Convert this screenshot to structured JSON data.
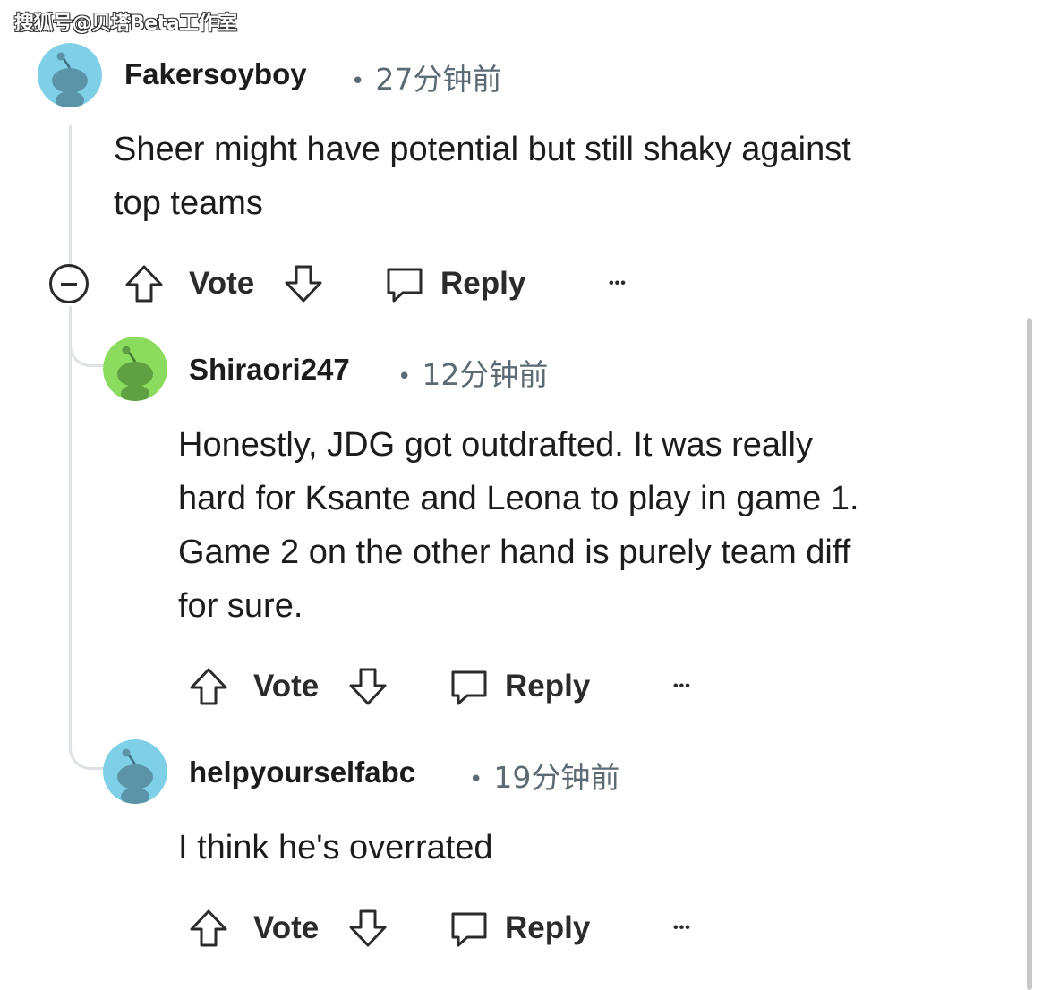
{
  "watermark": "搜狐号@贝塔Beta工作室",
  "comments": [
    {
      "author": "Fakersoyboy",
      "time": "27分钟前",
      "body_lines": [
        "Sheer might have potential but still shaky against",
        "top teams"
      ],
      "avatar_color": "#7fd0e6",
      "actions": {
        "vote": "Vote",
        "reply": "Reply",
        "more": "•••"
      }
    },
    {
      "author": "Shiraori247",
      "time": "12分钟前",
      "body_lines": [
        "Honestly, JDG got outdrafted. It was really",
        "hard for Ksante and Leona to play in game 1.",
        "Game 2 on the other hand is purely team diff",
        "for sure."
      ],
      "avatar_color": "#8bdc5e",
      "actions": {
        "vote": "Vote",
        "reply": "Reply",
        "more": "•••"
      }
    },
    {
      "author": "helpyourselfabc",
      "time": "19分钟前",
      "body_lines": [
        "I think he's overrated"
      ],
      "avatar_color": "#7fd0e6",
      "actions": {
        "vote": "Vote",
        "reply": "Reply",
        "more": "•••"
      }
    }
  ],
  "colors": {
    "text": "#1c1c1c",
    "meta": "#5c6b73",
    "thread_line": "#dfe2e5"
  }
}
